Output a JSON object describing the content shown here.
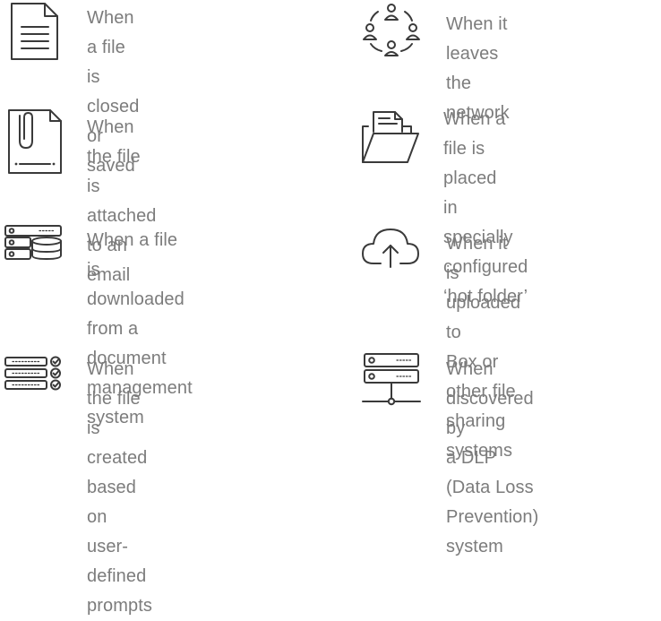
{
  "items": [
    {
      "label": "When a file is\nclosed or saved",
      "icon": "document-icon"
    },
    {
      "label": "When it leaves\nthe network",
      "icon": "network-people-icon"
    },
    {
      "label": "When the file is\nattached to an email",
      "icon": "paperclip-file-icon"
    },
    {
      "label": "When a file is placed\nin specially configured\n‘hot folder’",
      "icon": "open-folder-icon"
    },
    {
      "label": "When a file is downloaded\nfrom a document\nmanagement system",
      "icon": "server-database-icon"
    },
    {
      "label": "When it is uploaded to\nBox or other file\nsharing systems",
      "icon": "cloud-upload-icon"
    },
    {
      "label": "When the file is created\nbased on user-defined\nprompts",
      "icon": "checklist-icon"
    },
    {
      "label": "When discovered by\na DLP (Data Loss\nPrevention) system",
      "icon": "network-server-icon"
    }
  ]
}
